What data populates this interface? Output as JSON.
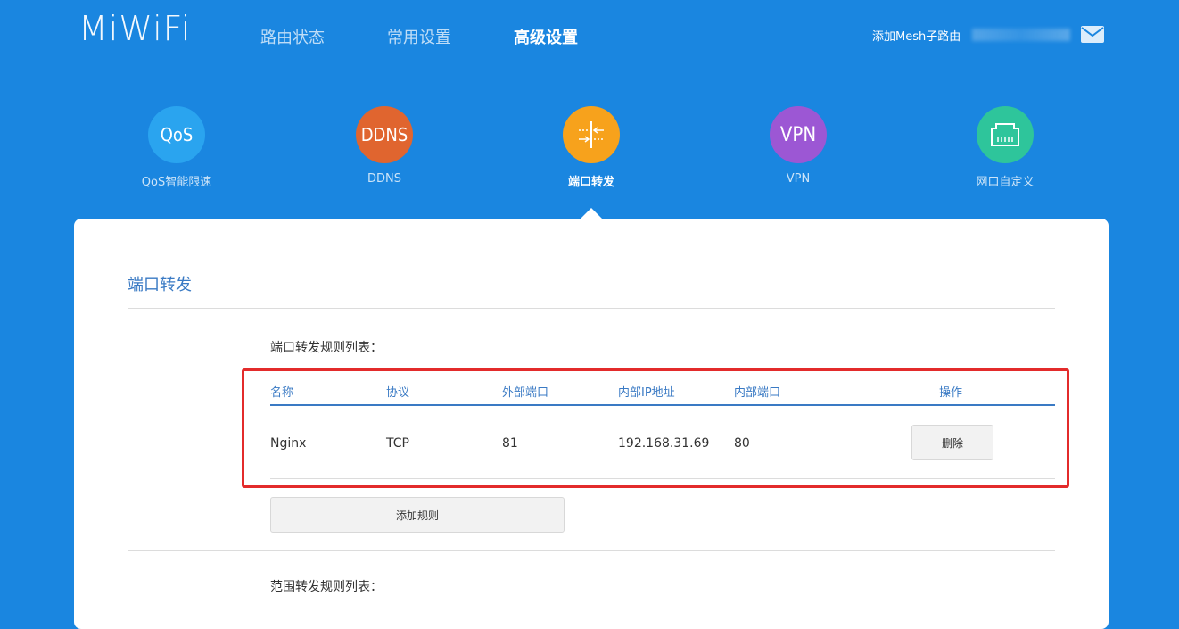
{
  "header": {
    "logo": "MiWiFi",
    "nav": [
      {
        "label": "路由状态",
        "active": false
      },
      {
        "label": "常用设置",
        "active": false
      },
      {
        "label": "高级设置",
        "active": true
      }
    ],
    "mesh_link": "添加Mesh子路由",
    "mail_icon": "mail-icon"
  },
  "features": [
    {
      "icon_text": "QoS",
      "label": "QoS智能限速",
      "color": "#2aa4ef",
      "active": false
    },
    {
      "icon_text": "DDNS",
      "label": "DDNS",
      "color": "#e0652f",
      "active": false
    },
    {
      "icon_text": "",
      "icon": "port-forward-icon",
      "label": "端口转发",
      "color": "#f7a21c",
      "active": true
    },
    {
      "icon_text": "VPN",
      "label": "VPN",
      "color": "#9c57d4",
      "active": false
    },
    {
      "icon_text": "",
      "icon": "ethernet-port-icon",
      "label": "网口自定义",
      "color": "#2ec59b",
      "active": false
    }
  ],
  "panel": {
    "title": "端口转发",
    "rules_label": "端口转发规则列表：",
    "columns": [
      "名称",
      "协议",
      "外部端口",
      "内部IP地址",
      "内部端口",
      "操作"
    ],
    "rows": [
      {
        "name": "Nginx",
        "protocol": "TCP",
        "ext_port": "81",
        "ip": "192.168.31.69",
        "int_port": "80",
        "action": "删除"
      }
    ],
    "add_button": "添加规则",
    "range_label": "范围转发规则列表："
  }
}
